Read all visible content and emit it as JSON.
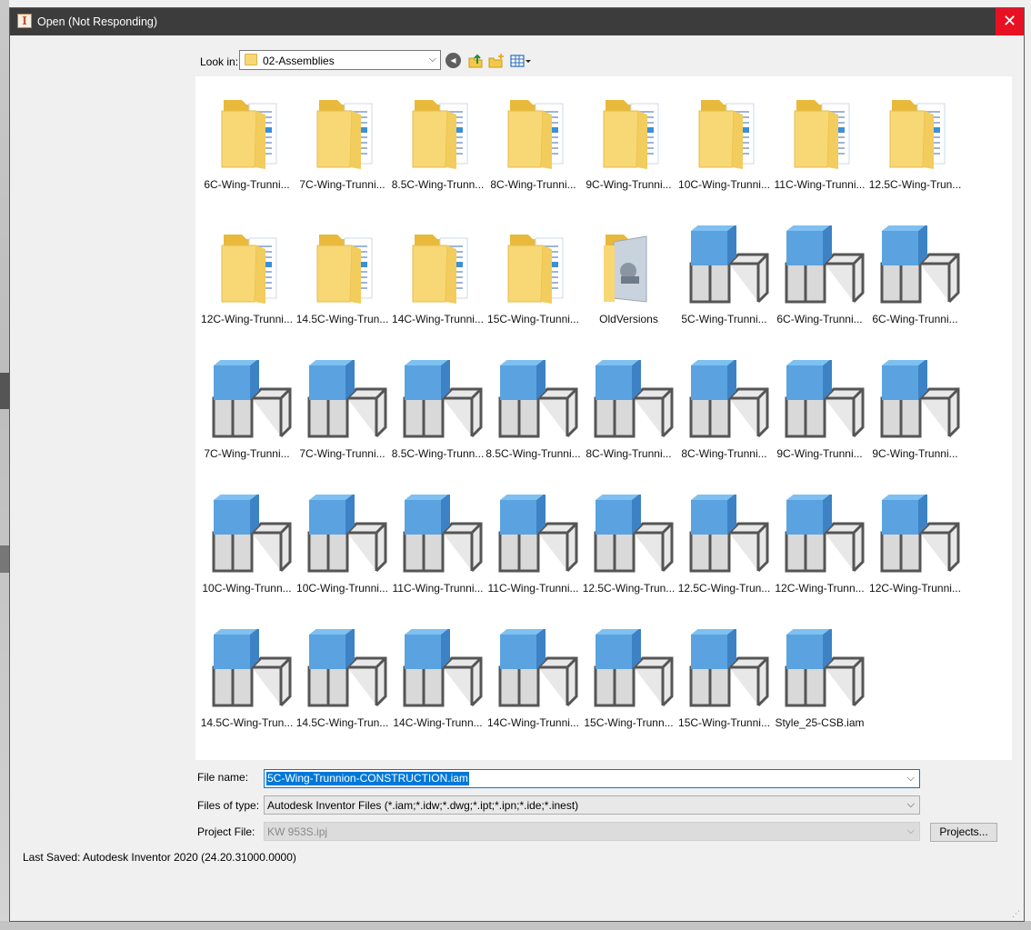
{
  "window": {
    "title": "Open (Not Responding)",
    "app_icon_letter": "I",
    "close_glyph": "✕"
  },
  "toolbar": {
    "look_in_label": "Look in:",
    "look_in_value": "02-Assemblies",
    "icons": [
      "back-icon",
      "up-folder-icon",
      "new-folder-icon",
      "views-menu-icon"
    ]
  },
  "files": [
    {
      "label": "6C-Wing-Trunni...",
      "type": "folder"
    },
    {
      "label": "7C-Wing-Trunni...",
      "type": "folder"
    },
    {
      "label": "8.5C-Wing-Trunn...",
      "type": "folder"
    },
    {
      "label": "8C-Wing-Trunni...",
      "type": "folder"
    },
    {
      "label": "9C-Wing-Trunni...",
      "type": "folder"
    },
    {
      "label": "10C-Wing-Trunni...",
      "type": "folder"
    },
    {
      "label": "11C-Wing-Trunni...",
      "type": "folder"
    },
    {
      "label": "12.5C-Wing-Trun...",
      "type": "folder"
    },
    {
      "label": "12C-Wing-Trunni...",
      "type": "folder"
    },
    {
      "label": "14.5C-Wing-Trun...",
      "type": "folder"
    },
    {
      "label": "14C-Wing-Trunni...",
      "type": "folder"
    },
    {
      "label": "15C-Wing-Trunni...",
      "type": "folder"
    },
    {
      "label": "OldVersions",
      "type": "folder-preview"
    },
    {
      "label": "5C-Wing-Trunni...",
      "type": "assembly"
    },
    {
      "label": "6C-Wing-Trunni...",
      "type": "assembly"
    },
    {
      "label": "6C-Wing-Trunni...",
      "type": "assembly"
    },
    {
      "label": "7C-Wing-Trunni...",
      "type": "assembly"
    },
    {
      "label": "7C-Wing-Trunni...",
      "type": "assembly"
    },
    {
      "label": "8.5C-Wing-Trunn...",
      "type": "assembly"
    },
    {
      "label": "8.5C-Wing-Trunni...",
      "type": "assembly"
    },
    {
      "label": "8C-Wing-Trunni...",
      "type": "assembly"
    },
    {
      "label": "8C-Wing-Trunni...",
      "type": "assembly"
    },
    {
      "label": "9C-Wing-Trunni...",
      "type": "assembly"
    },
    {
      "label": "9C-Wing-Trunni...",
      "type": "assembly"
    },
    {
      "label": "10C-Wing-Trunn...",
      "type": "assembly"
    },
    {
      "label": "10C-Wing-Trunni...",
      "type": "assembly"
    },
    {
      "label": "11C-Wing-Trunni...",
      "type": "assembly"
    },
    {
      "label": "11C-Wing-Trunni...",
      "type": "assembly"
    },
    {
      "label": "12.5C-Wing-Trun...",
      "type": "assembly"
    },
    {
      "label": "12.5C-Wing-Trun...",
      "type": "assembly"
    },
    {
      "label": "12C-Wing-Trunn...",
      "type": "assembly"
    },
    {
      "label": "12C-Wing-Trunni...",
      "type": "assembly"
    },
    {
      "label": "14.5C-Wing-Trun...",
      "type": "assembly"
    },
    {
      "label": "14.5C-Wing-Trun...",
      "type": "assembly"
    },
    {
      "label": "14C-Wing-Trunn...",
      "type": "assembly"
    },
    {
      "label": "14C-Wing-Trunni...",
      "type": "assembly"
    },
    {
      "label": "15C-Wing-Trunn...",
      "type": "assembly"
    },
    {
      "label": "15C-Wing-Trunni...",
      "type": "assembly"
    },
    {
      "label": "Style_25-CSB.iam",
      "type": "assembly"
    }
  ],
  "form": {
    "file_name_label": "File name:",
    "file_name_value": "5C-Wing-Trunnion-CONSTRUCTION.iam",
    "files_of_type_label": "Files of type:",
    "files_of_type_value": "Autodesk Inventor Files (*.iam;*.idw;*.dwg;*.ipt;*.ipn;*.ide;*.inest)",
    "project_file_label": "Project File:",
    "project_file_value": "KW 953S.ipj",
    "projects_button": "Projects..."
  },
  "status": {
    "last_saved": "Last Saved: Autodesk Inventor 2020 (24.20.31000.0000)"
  },
  "colors": {
    "titlebar": "#3c3c3c",
    "close": "#e81123",
    "accent": "#0078d7",
    "folder": "#f8d775",
    "assembly_blue": "#5aa3e0",
    "assembly_gray": "#d9d9d9"
  }
}
